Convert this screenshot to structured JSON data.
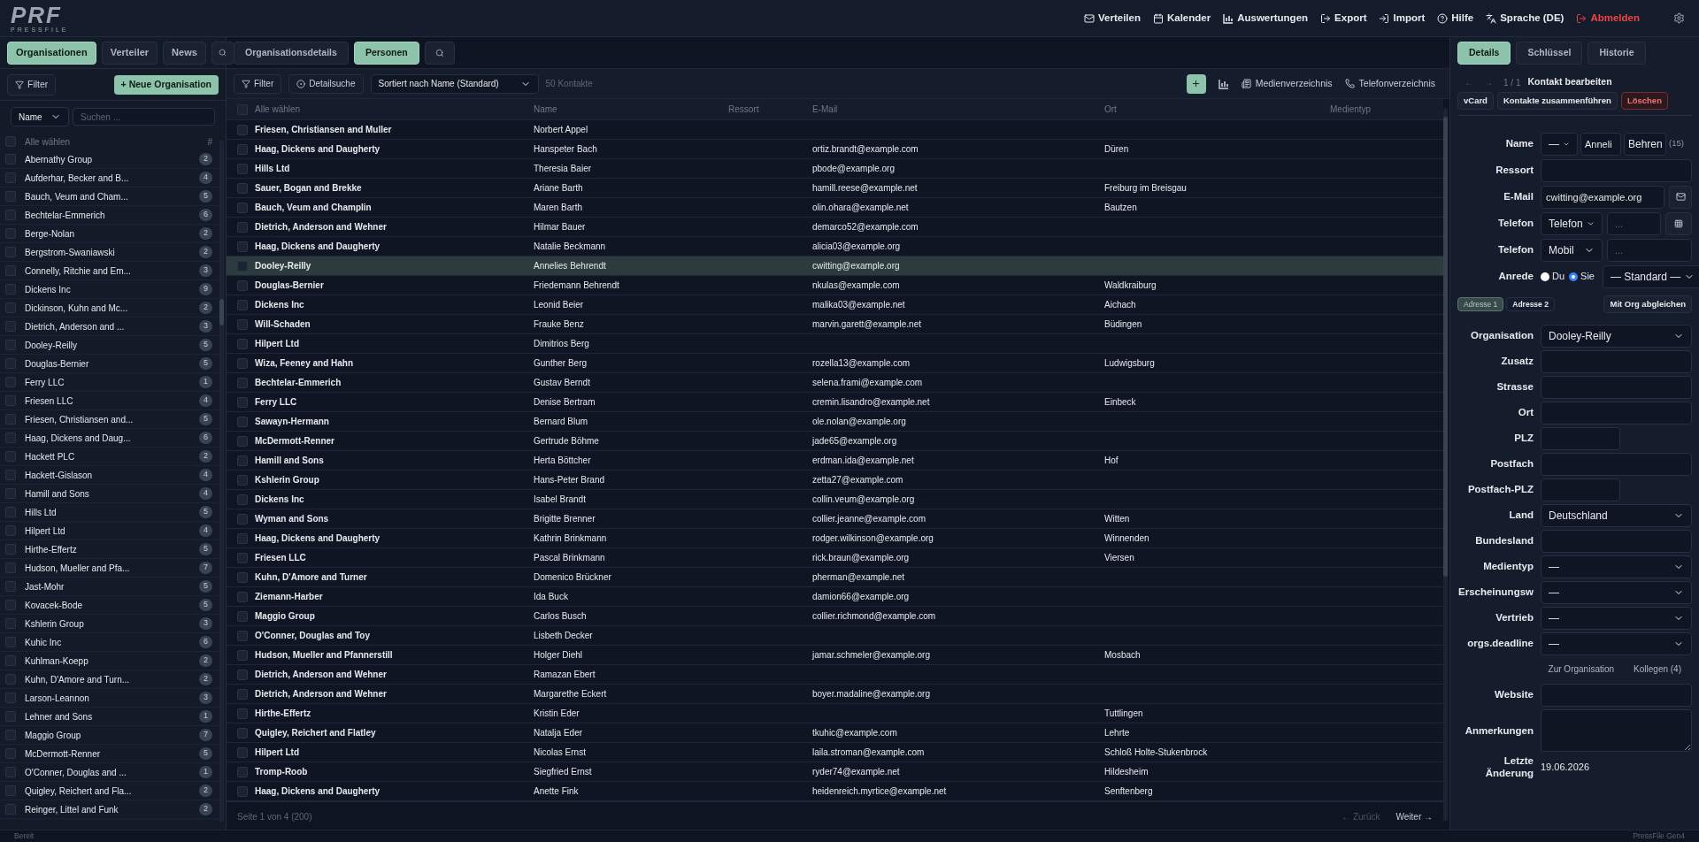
{
  "header": {
    "logo": "PRF",
    "logo_sub": "PRESSFILE",
    "nav": [
      {
        "label": "Verteilen",
        "danger": false
      },
      {
        "label": "Kalender",
        "danger": false
      },
      {
        "label": "Auswertungen",
        "danger": false
      },
      {
        "label": "Export",
        "danger": false
      },
      {
        "label": "Import",
        "danger": false
      },
      {
        "label": "Hilfe",
        "danger": false
      },
      {
        "label": "Sprache (DE)",
        "danger": false
      },
      {
        "label": "Abmelden",
        "danger": true
      }
    ]
  },
  "sidebar": {
    "tabs": [
      {
        "label": "Organisationen",
        "selected": true
      },
      {
        "label": "Verteiler",
        "selected": false
      },
      {
        "label": "News",
        "selected": false
      }
    ],
    "filter": "Filter",
    "new_button": "+ Neue Organisation",
    "field_select": "Name",
    "search": {
      "placeholder": "Suchen ..."
    },
    "header": "Alle wählen",
    "all_checked": false,
    "count_header": "#",
    "items": [
      {
        "name": "Abernathy Group",
        "count": "2",
        "checked": false
      },
      {
        "name": "Aufderhar, Becker and B...",
        "count": "4",
        "checked": false
      },
      {
        "name": "Bauch, Veum and Cham...",
        "count": "5",
        "checked": false
      },
      {
        "name": "Bechtelar-Emmerich",
        "count": "6",
        "checked": false
      },
      {
        "name": "Berge-Nolan",
        "count": "2",
        "checked": false
      },
      {
        "name": "Bergstrom-Swaniawski",
        "count": "2",
        "checked": false
      },
      {
        "name": "Connelly, Ritchie and Em...",
        "count": "3",
        "checked": false
      },
      {
        "name": "Dickens Inc",
        "count": "9",
        "checked": false
      },
      {
        "name": "Dickinson, Kuhn and Mc...",
        "count": "2",
        "checked": false
      },
      {
        "name": "Dietrich, Anderson and ...",
        "count": "3",
        "checked": false
      },
      {
        "name": "Dooley-Reilly",
        "count": "5",
        "checked": false
      },
      {
        "name": "Douglas-Bernier",
        "count": "5",
        "checked": false
      },
      {
        "name": "Ferry LLC",
        "count": "1",
        "checked": false
      },
      {
        "name": "Friesen LLC",
        "count": "4",
        "checked": false
      },
      {
        "name": "Friesen, Christiansen and...",
        "count": "5",
        "checked": false
      },
      {
        "name": "Haag, Dickens and Daug...",
        "count": "6",
        "checked": false
      },
      {
        "name": "Hackett PLC",
        "count": "2",
        "checked": false
      },
      {
        "name": "Hackett-Gislason",
        "count": "4",
        "checked": false
      },
      {
        "name": "Hamill and Sons",
        "count": "4",
        "checked": false
      },
      {
        "name": "Hills Ltd",
        "count": "5",
        "checked": false
      },
      {
        "name": "Hilpert Ltd",
        "count": "4",
        "checked": false
      },
      {
        "name": "Hirthe-Effertz",
        "count": "5",
        "checked": false
      },
      {
        "name": "Hudson, Mueller and Pfa...",
        "count": "7",
        "checked": false
      },
      {
        "name": "Jast-Mohr",
        "count": "5",
        "checked": false
      },
      {
        "name": "Kovacek-Bode",
        "count": "5",
        "checked": false
      },
      {
        "name": "Kshlerin Group",
        "count": "3",
        "checked": false
      },
      {
        "name": "Kuhic Inc",
        "count": "6",
        "checked": false
      },
      {
        "name": "Kuhlman-Koepp",
        "count": "2",
        "checked": false
      },
      {
        "name": "Kuhn, D'Amore and Turn...",
        "count": "2",
        "checked": false
      },
      {
        "name": "Larson-Leannon",
        "count": "3",
        "checked": false
      },
      {
        "name": "Lehner and Sons",
        "count": "1",
        "checked": false
      },
      {
        "name": "Maggio Group",
        "count": "7",
        "checked": false
      },
      {
        "name": "McDermott-Renner",
        "count": "5",
        "checked": false
      },
      {
        "name": "O'Conner, Douglas and ...",
        "count": "1",
        "checked": false
      },
      {
        "name": "Quigley, Reichert and Fla...",
        "count": "2",
        "checked": false
      },
      {
        "name": "Reinger, Littel and Funk",
        "count": "2",
        "checked": false
      }
    ]
  },
  "main": {
    "tabs": [
      {
        "label": "Organisationsdetails",
        "selected": false
      },
      {
        "label": "Personen",
        "selected": true
      }
    ],
    "toolbar": {
      "filter": "Filter",
      "detail_search": "Detailsuche",
      "sort": "Sortiert nach Name (Standard)",
      "count": "50 Kontakte",
      "media": "Medienverzeichnis",
      "phone": "Telefonverzeichnis"
    },
    "all_checked": false,
    "columns": [
      "Alle wählen",
      "Name",
      "Ressort",
      "E-Mail",
      "Ort",
      "Medientyp"
    ],
    "rows": [
      {
        "org": "Friesen, Christiansen and Muller",
        "name": "Norbert Appel",
        "checked": false,
        "selected": false
      },
      {
        "org": "Haag, Dickens and Daugherty",
        "name": "Hanspeter Bach",
        "email": "ortiz.brandt@example.com",
        "ort": "Düren",
        "checked": false,
        "selected": false
      },
      {
        "org": "Hills Ltd",
        "name": "Theresia Baier",
        "email": "pbode@example.org",
        "checked": false,
        "selected": false
      },
      {
        "org": "Sauer, Bogan and Brekke",
        "name": "Ariane Barth",
        "email": "hamill.reese@example.net",
        "ort": "Freiburg im Breisgau",
        "checked": false,
        "selected": false
      },
      {
        "org": "Bauch, Veum and Champlin",
        "name": "Maren Barth",
        "email": "olin.ohara@example.net",
        "ort": "Bautzen",
        "checked": false,
        "selected": false
      },
      {
        "org": "Dietrich, Anderson and Wehner",
        "name": "Hilmar Bauer",
        "email": "demarco52@example.com",
        "checked": false,
        "selected": false
      },
      {
        "org": "Haag, Dickens and Daugherty",
        "name": "Natalie Beckmann",
        "email": "alicia03@example.org",
        "checked": false,
        "selected": false
      },
      {
        "org": "Dooley-Reilly",
        "name": "Annelies Behrendt",
        "email": "cwitting@example.org",
        "checked": false,
        "selected": true
      },
      {
        "org": "Douglas-Bernier",
        "name": "Friedemann Behrendt",
        "email": "nkulas@example.com",
        "ort": "Waldkraiburg",
        "checked": false,
        "selected": false
      },
      {
        "org": "Dickens Inc",
        "name": "Leonid Beier",
        "email": "malika03@example.net",
        "ort": "Aichach",
        "checked": false,
        "selected": false
      },
      {
        "org": "Will-Schaden",
        "name": "Frauke Benz",
        "email": "marvin.garett@example.net",
        "ort": "Büdingen",
        "checked": false,
        "selected": false
      },
      {
        "org": "Hilpert Ltd",
        "name": "Dimitrios Berg",
        "checked": false,
        "selected": false
      },
      {
        "org": "Wiza, Feeney and Hahn",
        "name": "Gunther Berg",
        "email": "rozella13@example.com",
        "ort": "Ludwigsburg",
        "checked": false,
        "selected": false
      },
      {
        "org": "Bechtelar-Emmerich",
        "name": "Gustav Berndt",
        "email": "selena.frami@example.com",
        "checked": false,
        "selected": false
      },
      {
        "org": "Ferry LLC",
        "name": "Denise Bertram",
        "email": "cremin.lisandro@example.net",
        "ort": "Einbeck",
        "checked": false,
        "selected": false
      },
      {
        "org": "Sawayn-Hermann",
        "name": "Bernard Blum",
        "email": "ole.nolan@example.org",
        "checked": false,
        "selected": false
      },
      {
        "org": "McDermott-Renner",
        "name": "Gertrude Böhme",
        "email": "jade65@example.org",
        "checked": false,
        "selected": false
      },
      {
        "org": "Hamill and Sons",
        "name": "Herta Böttcher",
        "email": "erdman.ida@example.net",
        "ort": "Hof",
        "checked": false,
        "selected": false
      },
      {
        "org": "Kshlerin Group",
        "name": "Hans-Peter Brand",
        "email": "zetta27@example.com",
        "checked": false,
        "selected": false
      },
      {
        "org": "Dickens Inc",
        "name": "Isabel Brandt",
        "email": "collin.veum@example.org",
        "checked": false,
        "selected": false
      },
      {
        "org": "Wyman and Sons",
        "name": "Brigitte Brenner",
        "email": "collier.jeanne@example.com",
        "ort": "Witten",
        "checked": false,
        "selected": false
      },
      {
        "org": "Haag, Dickens and Daugherty",
        "name": "Kathrin Brinkmann",
        "email": "rodger.wilkinson@example.org",
        "ort": "Winnenden",
        "checked": false,
        "selected": false
      },
      {
        "org": "Friesen LLC",
        "name": "Pascal Brinkmann",
        "email": "rick.braun@example.org",
        "ort": "Viersen",
        "checked": false,
        "selected": false
      },
      {
        "org": "Kuhn, D'Amore and Turner",
        "name": "Domenico Brückner",
        "email": "pherman@example.net",
        "checked": false,
        "selected": false
      },
      {
        "org": "Ziemann-Harber",
        "name": "Ida Buck",
        "email": "damion66@example.org",
        "checked": false,
        "selected": false
      },
      {
        "org": "Maggio Group",
        "name": "Carlos Busch",
        "email": "collier.richmond@example.com",
        "checked": false,
        "selected": false
      },
      {
        "org": "O'Conner, Douglas and Toy",
        "name": "Lisbeth Decker",
        "checked": false,
        "selected": false
      },
      {
        "org": "Hudson, Mueller and Pfannerstill",
        "name": "Holger Diehl",
        "email": "jamar.schmeler@example.org",
        "ort": "Mosbach",
        "checked": false,
        "selected": false
      },
      {
        "org": "Dietrich, Anderson and Wehner",
        "name": "Ramazan Ebert",
        "checked": false,
        "selected": false
      },
      {
        "org": "Dietrich, Anderson and Wehner",
        "name": "Margarethe Eckert",
        "email": "boyer.madaline@example.org",
        "checked": false,
        "selected": false
      },
      {
        "org": "Hirthe-Effertz",
        "name": "Kristin Eder",
        "ort": "Tuttlingen",
        "checked": false,
        "selected": false
      },
      {
        "org": "Quigley, Reichert and Flatley",
        "name": "Natalja Eder",
        "email": "tkuhic@example.com",
        "ort": "Lehrte",
        "checked": false,
        "selected": false
      },
      {
        "org": "Hilpert Ltd",
        "name": "Nicolas Ernst",
        "email": "laila.stroman@example.com",
        "ort": "Schloß Holte-Stukenbrock",
        "checked": false,
        "selected": false
      },
      {
        "org": "Tromp-Roob",
        "name": "Siegfried Ernst",
        "email": "ryder74@example.net",
        "ort": "Hildesheim",
        "checked": false,
        "selected": false
      },
      {
        "org": "Haag, Dickens and Daugherty",
        "name": "Anette Fink",
        "email": "heidenreich.myrtice@example.net",
        "ort": "Senftenberg",
        "checked": false,
        "selected": false
      }
    ],
    "footer": {
      "page": "Seite 1 von 4 (200)",
      "prev": {
        "label": "← Zurück",
        "disabled": true
      },
      "next": {
        "label": "Weiter →",
        "disabled": false
      }
    }
  },
  "detail": {
    "tabs": [
      {
        "label": "Details",
        "selected": true
      },
      {
        "label": "Schlüssel",
        "selected": false
      },
      {
        "label": "Historie",
        "selected": false
      }
    ],
    "prev": "←",
    "next": "→",
    "position": "1 / 1",
    "title": "Kontakt bearbeiten",
    "actions": [
      {
        "label": "vCard",
        "danger": false
      },
      {
        "label": "Kontakte zusammenführen",
        "danger": false
      },
      {
        "label": "Löschen",
        "danger": true
      }
    ],
    "contact_fields": [
      {
        "kind": "name",
        "label": "Name",
        "salutation": "—",
        "first": "Anneli",
        "last": "Behren",
        "count": "(15)"
      },
      {
        "kind": "text",
        "label": "Ressort"
      },
      {
        "kind": "email",
        "label": "E-Mail",
        "value": "cwitting@example.org"
      },
      {
        "kind": "phone",
        "label": "Telefon",
        "type": "Telefon",
        "placeholder": "...",
        "has_button": true
      },
      {
        "kind": "phone",
        "label": "Telefon",
        "type": "Mobil",
        "placeholder": "...",
        "has_button": false
      },
      {
        "kind": "salutation",
        "label": "Anrede",
        "options": [
          {
            "label": "Du",
            "selected": false
          },
          {
            "label": "Sie",
            "selected": true
          }
        ],
        "value": "— Standard —"
      }
    ],
    "address_tabs": [
      {
        "label": "Adresse 1",
        "selected": true
      },
      {
        "label": "Adresse 2",
        "selected": false
      }
    ],
    "sync_button": "Mit Org abgleichen",
    "address_fields": [
      {
        "kind": "select",
        "label": "Organisation",
        "value": "Dooley-Reilly"
      },
      {
        "kind": "text",
        "label": "Zusatz"
      },
      {
        "kind": "text",
        "label": "Strasse"
      },
      {
        "kind": "text",
        "label": "Ort"
      },
      {
        "kind": "short",
        "label": "PLZ"
      },
      {
        "kind": "text",
        "label": "Postfach"
      },
      {
        "kind": "short",
        "label": "Postfach-PLZ"
      },
      {
        "kind": "select",
        "label": "Land",
        "value": "Deutschland"
      },
      {
        "kind": "text",
        "label": "Bundesland"
      },
      {
        "kind": "select",
        "label": "Medientyp",
        "value": "—"
      },
      {
        "kind": "select",
        "label": "Erscheinungsw",
        "value": "—"
      },
      {
        "kind": "select",
        "label": "Vertrieb",
        "value": "—"
      },
      {
        "kind": "select",
        "label": "orgs.deadline",
        "value": "—"
      }
    ],
    "links": [
      "Zur Organisation",
      "Kollegen (4)"
    ],
    "extra_fields": [
      {
        "kind": "text",
        "label": "Website"
      },
      {
        "kind": "textarea",
        "label": "Anmerkungen"
      },
      {
        "kind": "static",
        "label": "Letzte Änderung",
        "value": "19.06.2026"
      }
    ]
  },
  "status_bar": {
    "left": "Bereit",
    "right": "PressFile Gen4"
  }
}
